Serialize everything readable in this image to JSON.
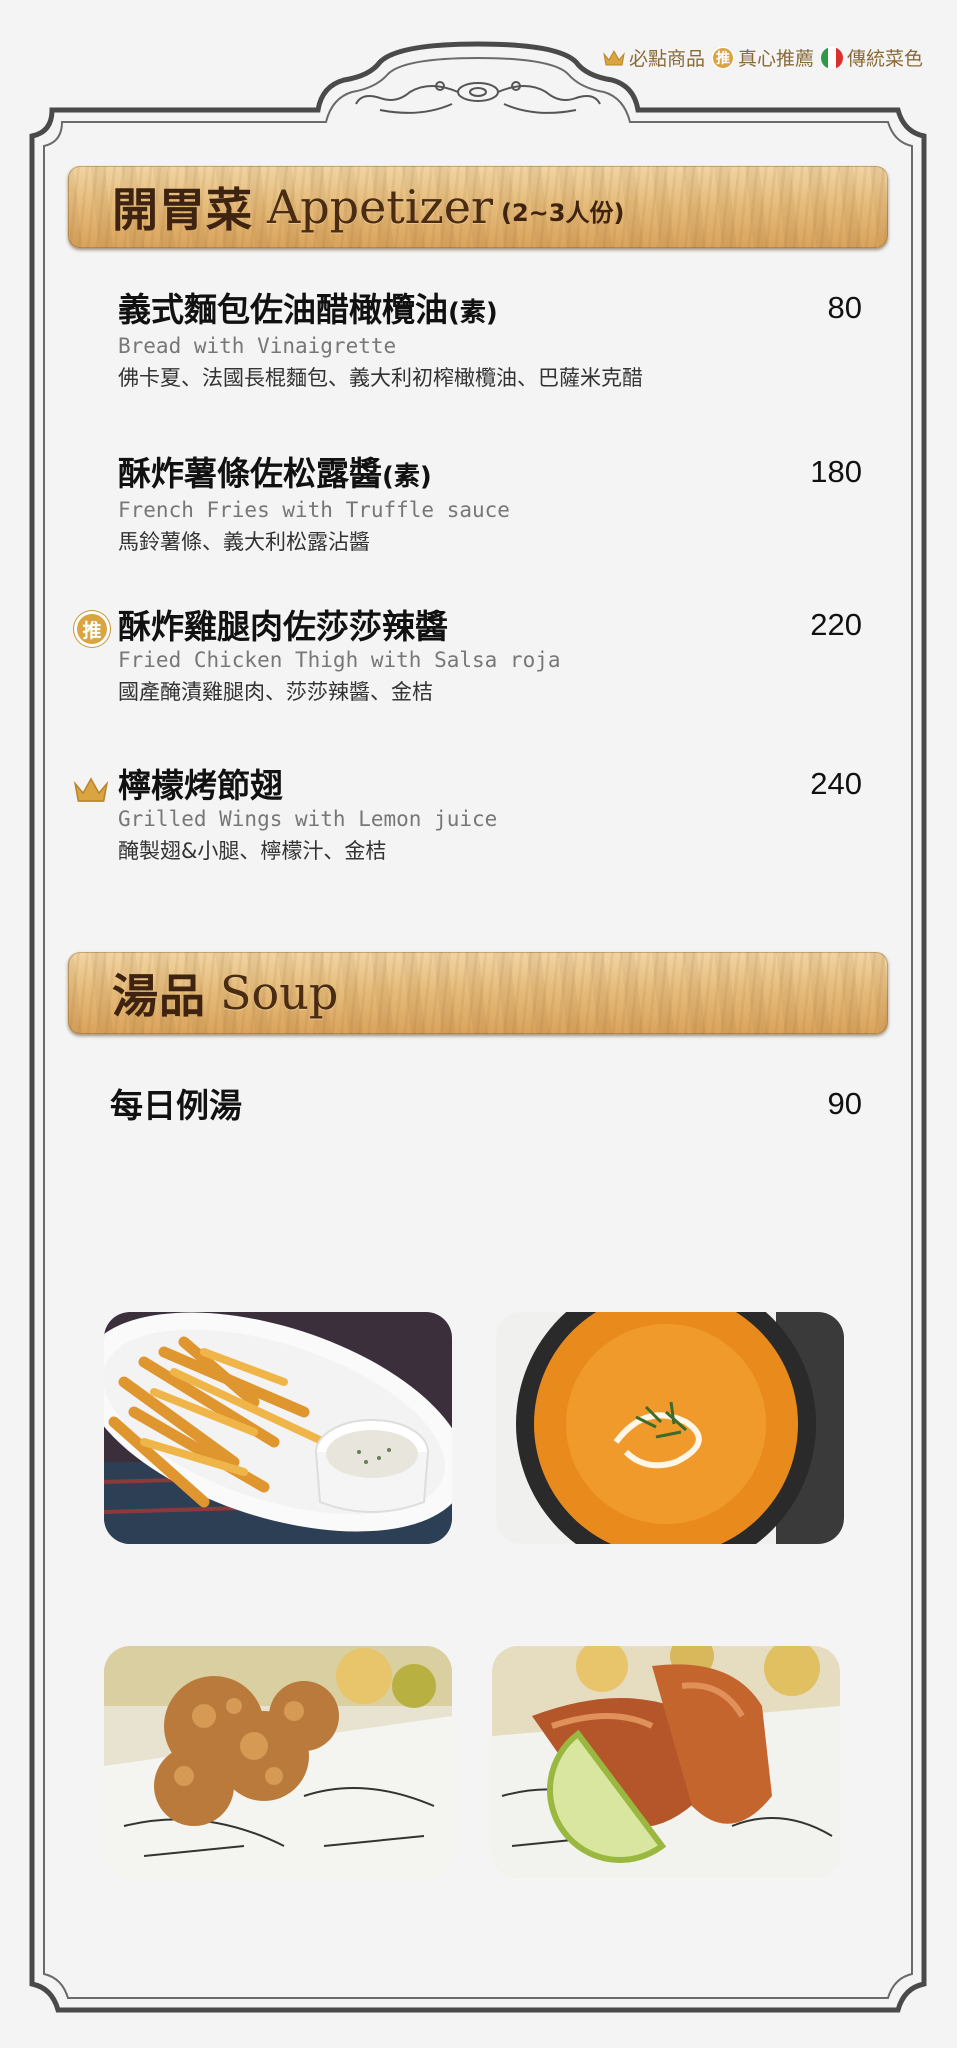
{
  "legend": {
    "must_order": "必點商品",
    "recommend": "真心推薦",
    "traditional": "傳統菜色",
    "badge_char": "推"
  },
  "sections": [
    {
      "title_cn": "開胃菜",
      "title_en": "Appetizer",
      "servings": "(2~3人份)",
      "items": [
        {
          "name": "義式麵包佐油醋橄欖油",
          "tag": "(素)",
          "en": "Bread with Vinaigrette",
          "desc": "佛卡夏、法國長棍麵包、義大利初榨橄欖油、巴薩米克醋",
          "price": "80",
          "badge": ""
        },
        {
          "name": "酥炸薯條佐松露醬",
          "tag": "(素)",
          "en": "French Fries with Truffle sauce",
          "desc": "馬鈴薯條、義大利松露沾醬",
          "price": "180",
          "badge": ""
        },
        {
          "name": "酥炸雞腿肉佐莎莎辣醬",
          "tag": "",
          "en": "Fried Chicken Thigh with Salsa roja",
          "desc": "國產醃漬雞腿肉、莎莎辣醬、金桔",
          "price": "220",
          "badge": "recommend"
        },
        {
          "name": "檸檬烤節翅",
          "tag": "",
          "en": "Grilled Wings with Lemon juice",
          "desc": "醃製翅&小腿、檸檬汁、金桔",
          "price": "240",
          "badge": "crown"
        }
      ]
    },
    {
      "title_cn": "湯品",
      "title_en": "Soup",
      "items": [
        {
          "name": "每日例湯",
          "price": "90"
        }
      ]
    }
  ],
  "colors": {
    "frame": "#4a4a4a",
    "banner_wood": "#e3b776",
    "banner_text": "#3e2410",
    "gold": "#d9a441",
    "legend_text": "#8a6a38",
    "italy_green": "#2e9a45",
    "italy_red": "#d9312b"
  },
  "photos": [
    {
      "name": "french-fries-photo"
    },
    {
      "name": "pumpkin-soup-photo"
    },
    {
      "name": "fried-chicken-photo"
    },
    {
      "name": "grilled-wings-photo"
    }
  ]
}
